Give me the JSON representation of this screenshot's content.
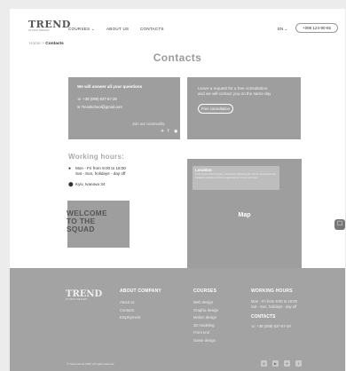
{
  "header": {
    "logo_main": "TREND",
    "logo_sub": "STUDIO DESIGN",
    "nav": [
      "COURSES ⌄",
      "ABOUT US",
      "CONTACTS"
    ],
    "lang": "EN ⌄",
    "phone": "+098 124-90-65"
  },
  "breadcrumb": {
    "home": "Home",
    "sep": ">",
    "current": "Contacts"
  },
  "page_title": "Contacts",
  "card_answer": {
    "heading": "We will answer all your questions",
    "phone": "+38 (099) 837-67-28",
    "email": "Trendschool@gmail.com",
    "follow": "Join our community:",
    "social": [
      "✈",
      "f",
      "◉"
    ]
  },
  "card_consult": {
    "line1": "Leave a request for a free consultation",
    "line2": "and we will contact you on the same day",
    "button": "Free consultation"
  },
  "working_hours": {
    "title": "Working hours:",
    "line1": "Mon - Fri from 9:00 to 18:00",
    "line2": "Sat - Sun, holidays - day off",
    "address": "Kyiv, Ivanova 34"
  },
  "squad": {
    "line1": "WELCOME",
    "line2": "TO THE",
    "line3": "SQUAD"
  },
  "map": {
    "label": "Map",
    "location_title": "Location",
    "location_text": "Lorem ipsum dolor sit amet, consectetur adipiscing elit, sed do eiusmod tempor incididunt ut labore et dolore magna aliqua. Ut enim ad minim"
  },
  "chat_icon": "☐",
  "footer": {
    "logo_main": "TREND",
    "logo_sub": "STUDIO DESIGN",
    "about": {
      "title": "ABOUT COMPANY",
      "items": [
        "About us",
        "Contacts",
        "Employment"
      ]
    },
    "courses": {
      "title": "COURSES",
      "items": [
        "Web design",
        "Graphic design",
        "Motion design",
        "3D modeling",
        "Front end",
        "Game design"
      ]
    },
    "hours": {
      "title": "WORKING HOURS",
      "line1": "Mon - Fri from 9:00 to 18:00",
      "line2": "Sat - Sun, holidays - day off",
      "contacts_title": "CONTACTS",
      "phone": "+38 (099) 837-67-28"
    },
    "copyright": "© Trend school 2023, All rights reserved",
    "social": [
      "◎",
      "▶",
      "✈",
      "f"
    ]
  }
}
